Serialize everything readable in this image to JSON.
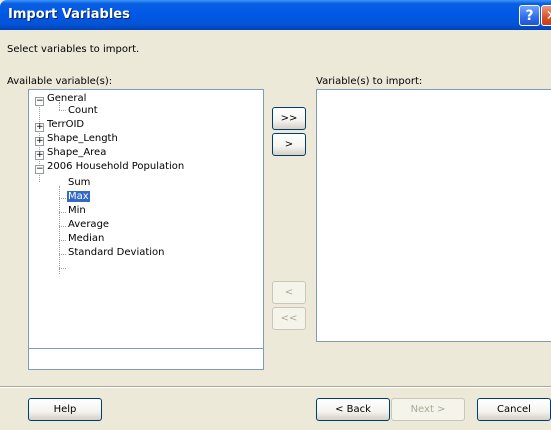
{
  "window": {
    "title": "Import Variables",
    "help_glyph": "?",
    "close_glyph": "✕"
  },
  "instructions": "Select variables to import.",
  "available": {
    "label": "Available variable(s):",
    "tree": [
      {
        "label": "General",
        "expander": "−"
      },
      {
        "label": "Count"
      },
      {
        "label": "TerrOID",
        "expander": "+"
      },
      {
        "label": "Shape_Length",
        "expander": "+"
      },
      {
        "label": "Shape_Area",
        "expander": "+"
      },
      {
        "label": "2006 Household Population",
        "expander": "−"
      },
      {
        "label": "Sum"
      },
      {
        "label": "Max",
        "selected": true
      },
      {
        "label": "Min"
      },
      {
        "label": "Average"
      },
      {
        "label": "Median"
      },
      {
        "label": "Standard Deviation"
      }
    ],
    "filter_value": ""
  },
  "import": {
    "label": "Variable(s) to import:"
  },
  "transfer_buttons": {
    "add_all": ">>",
    "add": ">",
    "remove": "<",
    "remove_all": "<<"
  },
  "footer": {
    "help": "Help",
    "back": "< Back",
    "next": "Next >",
    "cancel": "Cancel"
  },
  "colors": {
    "titlebar": "#0058e6",
    "selection": "#316ac5",
    "dialog_bg": "#ece9d8"
  }
}
